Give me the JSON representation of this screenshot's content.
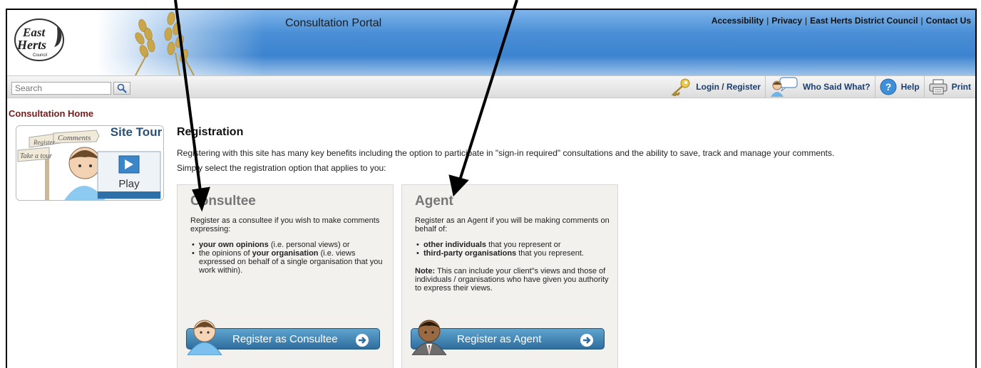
{
  "header": {
    "logo_text_line1": "East",
    "logo_text_line2": "Herts",
    "logo_text_line3": "Council",
    "portal_title": "Consultation Portal",
    "links": [
      "Accessibility",
      "Privacy",
      "East Herts District Council",
      "Contact Us"
    ],
    "separator": "|"
  },
  "toolbar": {
    "search_placeholder": "Search",
    "tools": [
      {
        "label": "Login / Register",
        "icon": "key-icon"
      },
      {
        "label": "Who Said What?",
        "icon": "speech-person-icon"
      },
      {
        "label": "Help",
        "icon": "help-icon"
      },
      {
        "label": "Print",
        "icon": "printer-icon"
      }
    ]
  },
  "sidebar": {
    "home_link": "Consultation Home",
    "site_tour": {
      "title": "Site Tour",
      "play": "Play",
      "signs": [
        "Register",
        "Comments",
        "Take a tour"
      ]
    }
  },
  "main": {
    "title": "Registration",
    "intro": "Registering with this site has many key benefits including the option to participate in \"sign-in required\" consultations and the ability to save, track and manage your comments.",
    "select_text": "Simply select the registration option that applies to you:",
    "consultee": {
      "heading": "Consultee",
      "lead": "Register as a consultee if you wish to make comments expressing:",
      "items": [
        {
          "bold": "your own opinions",
          "rest": " (i.e. personal views) or"
        },
        {
          "pre": "the opinions of ",
          "bold": "your organisation",
          "rest": " (i.e. views expressed on behalf of a single organisation that you work within)."
        }
      ],
      "button": "Register as Consultee"
    },
    "agent": {
      "heading": "Agent",
      "lead": "Register as an Agent if you will be making comments on behalf of:",
      "items": [
        {
          "bold": "other individuals",
          "rest": " that you represent or"
        },
        {
          "bold": "third-party organisations",
          "rest": " that you represent."
        }
      ],
      "note_bold": "Note:",
      "note_rest": " This can include your client\"s views and those of individuals / organisations who have given you authority to express their views.",
      "button": "Register as Agent"
    }
  },
  "colors": {
    "header_blue": "#3c83cf",
    "home_link": "#7a1a1a",
    "button_blue": "#2f6d9e",
    "annotation": "#000000"
  }
}
